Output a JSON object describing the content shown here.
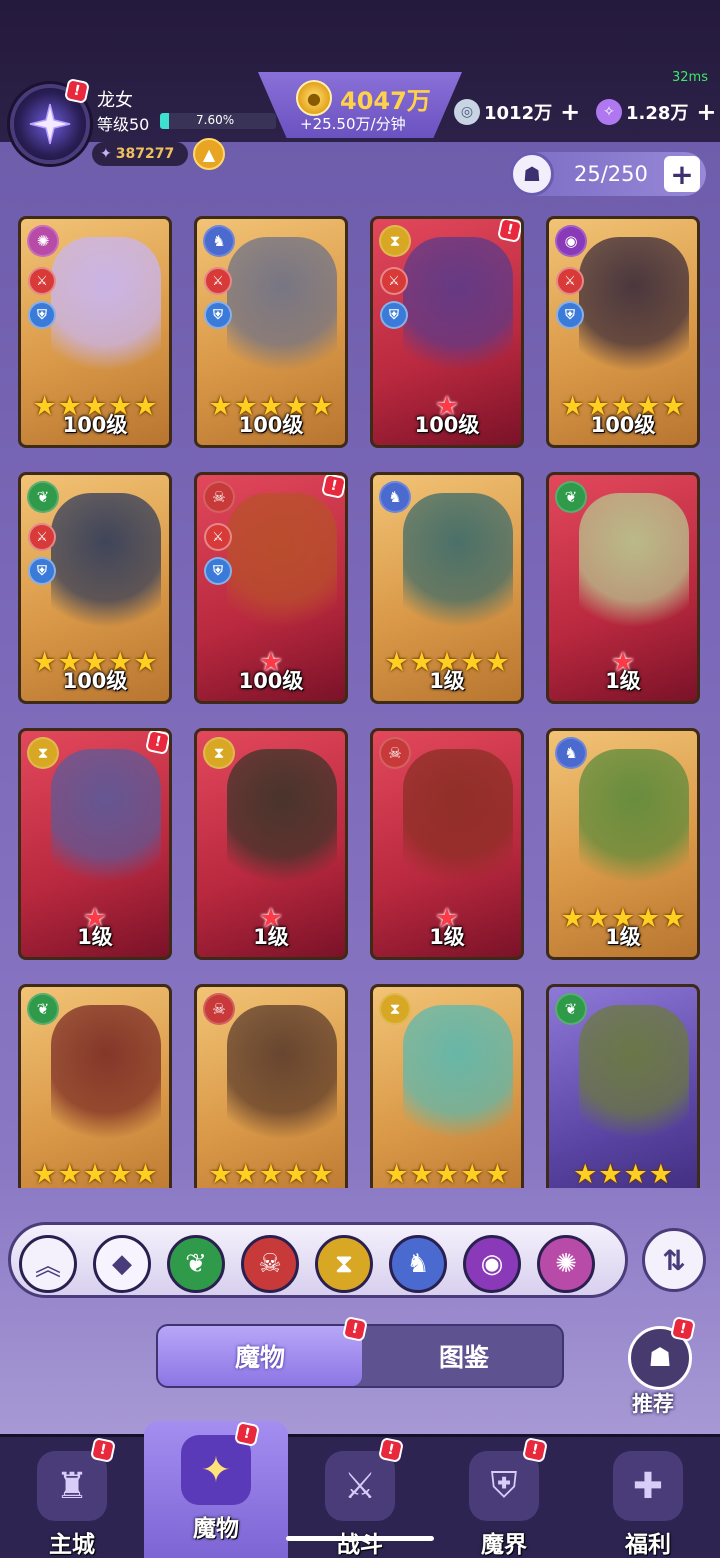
{
  "status": {
    "ping": "32ms"
  },
  "player": {
    "name": "龙女",
    "level": "等级50",
    "xp_percent": "7.60%",
    "xp_fraction": 0.076,
    "power": "387277"
  },
  "currency": {
    "gold": "4047万",
    "gold_rate": "+25.50万/分钟",
    "gem": "1012万",
    "crystal": "1.28万"
  },
  "roster": {
    "count": "25/250"
  },
  "cards": [
    {
      "level": "100级",
      "frame": "gold",
      "stars": 5,
      "star_color": "gold",
      "faction": "wind-icon",
      "faction_color": "#b84aa8",
      "art": "#c8b6f6",
      "tags": true,
      "notif": false
    },
    {
      "level": "100级",
      "frame": "gold",
      "stars": 5,
      "star_color": "gold",
      "faction": "dragon-icon",
      "faction_color": "#4a6ad0",
      "art": "#6c7088",
      "tags": true,
      "notif": false
    },
    {
      "level": "100级",
      "frame": "red",
      "stars": 1,
      "star_color": "red",
      "faction": "hourglass-icon",
      "faction_color": "#d8a824",
      "art": "#5a3a8a",
      "tags": true,
      "notif": true
    },
    {
      "level": "100级",
      "frame": "gold",
      "stars": 5,
      "star_color": "gold",
      "faction": "eye-icon",
      "faction_color": "#8a3ab8",
      "art": "#3a2a3a",
      "tags": true,
      "notif": false
    },
    {
      "level": "100级",
      "frame": "gold",
      "stars": 5,
      "star_color": "gold",
      "faction": "leaf-icon",
      "faction_color": "#2e9a4a",
      "art": "#2e3a5a",
      "tags": true,
      "notif": false
    },
    {
      "level": "100级",
      "frame": "red",
      "stars": 1,
      "star_color": "red",
      "faction": "demon-icon",
      "faction_color": "#c83a3a",
      "art": "#b8502a",
      "tags": true,
      "notif": true
    },
    {
      "level": "1级",
      "frame": "gold",
      "stars": 5,
      "star_color": "gold",
      "faction": "dragon-icon",
      "faction_color": "#4a6ad0",
      "art": "#3a6a6a",
      "tags": false,
      "notif": false
    },
    {
      "level": "1级",
      "frame": "red",
      "stars": 1,
      "star_color": "red",
      "faction": "leaf-icon",
      "faction_color": "#2e9a4a",
      "art": "#b8c890",
      "tags": false,
      "notif": false
    },
    {
      "level": "1级",
      "frame": "red",
      "stars": 1,
      "star_color": "red",
      "faction": "hourglass-icon",
      "faction_color": "#d8a824",
      "art": "#5a5a9a",
      "tags": false,
      "notif": true
    },
    {
      "level": "1级",
      "frame": "red",
      "stars": 1,
      "star_color": "red",
      "faction": "hourglass-icon",
      "faction_color": "#d8a824",
      "art": "#3a3428",
      "tags": false,
      "notif": false
    },
    {
      "level": "1级",
      "frame": "red",
      "stars": 1,
      "star_color": "red",
      "faction": "demon-icon",
      "faction_color": "#c83a3a",
      "art": "#8a2e24",
      "tags": false,
      "notif": false
    },
    {
      "level": "1级",
      "frame": "gold",
      "stars": 5,
      "star_color": "gold",
      "faction": "dragon-icon",
      "faction_color": "#4a6ad0",
      "art": "#5a8a3a",
      "tags": false,
      "notif": false
    },
    {
      "level": "",
      "frame": "gold",
      "stars": 5,
      "star_color": "gold",
      "faction": "leaf-icon",
      "faction_color": "#2e9a4a",
      "art": "#7a2a24",
      "tags": false,
      "notif": false
    },
    {
      "level": "",
      "frame": "gold",
      "stars": 5,
      "star_color": "gold",
      "faction": "demon-icon",
      "faction_color": "#c83a3a",
      "art": "#5a3a2a",
      "tags": false,
      "notif": false
    },
    {
      "level": "",
      "frame": "gold",
      "stars": 5,
      "star_color": "gold",
      "faction": "hourglass-icon",
      "faction_color": "#d8a824",
      "art": "#5ab8b0",
      "tags": false,
      "notif": false
    },
    {
      "level": "",
      "frame": "purple",
      "stars": 4,
      "star_color": "gold",
      "faction": "leaf-icon",
      "faction_color": "#2e9a4a",
      "art": "#6a7a3a",
      "tags": false,
      "notif": false
    }
  ],
  "filters": [
    {
      "name": "collapse-icon",
      "color": "#f4f0fc",
      "glyph": "︽"
    },
    {
      "name": "all-icon",
      "color": "#f8f4ff",
      "glyph": "◆"
    },
    {
      "name": "leaf-icon",
      "color": "#2e9a4a",
      "glyph": "❦"
    },
    {
      "name": "demon-icon",
      "color": "#c83a3a",
      "glyph": "☠"
    },
    {
      "name": "hourglass-icon",
      "color": "#d8a824",
      "glyph": "⧗"
    },
    {
      "name": "dragon-icon",
      "color": "#4a6ad0",
      "glyph": "♞"
    },
    {
      "name": "eye-icon",
      "color": "#8a3ab8",
      "glyph": "◉"
    },
    {
      "name": "wind-icon",
      "color": "#b84aa8",
      "glyph": "✺"
    }
  ],
  "tabs": {
    "monsters": "魔物",
    "codex": "图鉴"
  },
  "recommend": "推荐",
  "nav": [
    {
      "label": "主城",
      "icon": "castle-icon",
      "glyph": "♜",
      "active": false,
      "notif": true
    },
    {
      "label": "魔物",
      "icon": "monster-flame-icon",
      "glyph": "✦",
      "active": true,
      "notif": true
    },
    {
      "label": "战斗",
      "icon": "sword-icon",
      "glyph": "⚔",
      "active": false,
      "notif": true
    },
    {
      "label": "魔界",
      "icon": "realm-icon",
      "glyph": "⛨",
      "active": false,
      "notif": true
    },
    {
      "label": "福利",
      "icon": "chest-icon",
      "glyph": "✚",
      "active": false,
      "notif": false
    }
  ]
}
